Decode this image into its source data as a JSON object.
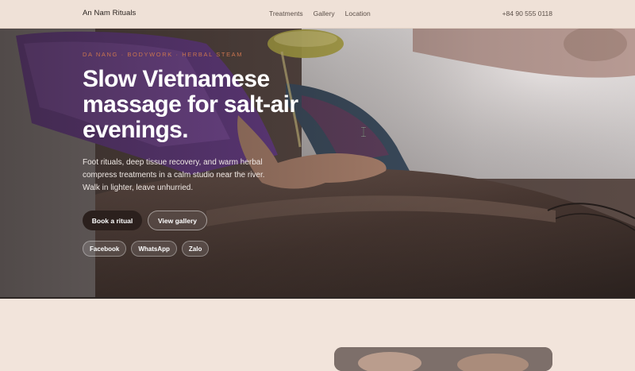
{
  "header": {
    "brand": "An Nam Rituals",
    "nav": [
      {
        "label": "Treatments"
      },
      {
        "label": "Gallery"
      },
      {
        "label": "Location"
      }
    ],
    "phone": "+84 90 555 0118"
  },
  "hero": {
    "eyebrow": "DA NANG · BODYWORK · HERBAL STEAM",
    "headline": "Slow Vietnamese massage for salt-air evenings.",
    "lede": "Foot rituals, deep tissue recovery, and warm herbal compress treatments in a calm studio near the river. Walk in lighter, leave unhurried.",
    "primary_cta": "Book a ritual",
    "secondary_cta": "View gallery",
    "socials": [
      {
        "label": "Facebook"
      },
      {
        "label": "WhatsApp"
      },
      {
        "label": "Zalo"
      }
    ]
  },
  "icons": {
    "cursor": "text-cursor-icon"
  },
  "colors": {
    "header_bg": "#efe1d7",
    "accent": "#c9744f",
    "primary_button": "#2b201d",
    "page_bg": "#f2e4db"
  }
}
